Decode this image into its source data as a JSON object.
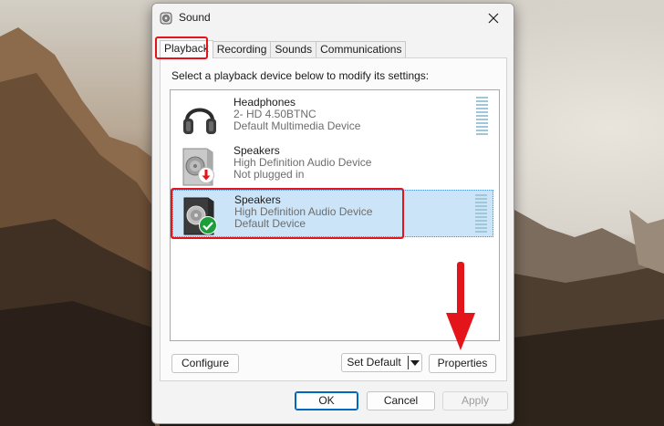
{
  "window": {
    "title": "Sound",
    "title_icon": "speaker-icon"
  },
  "tabs": [
    {
      "label": "Playback",
      "active": true
    },
    {
      "label": "Recording",
      "active": false
    },
    {
      "label": "Sounds",
      "active": false
    },
    {
      "label": "Communications",
      "active": false
    }
  ],
  "panel": {
    "instruction": "Select a playback device below to modify its settings:"
  },
  "devices": [
    {
      "name": "Headphones",
      "line2": "2- HD 4.50BTNC",
      "line3": "Default Multimedia Device",
      "icon": "headphones-icon"
    },
    {
      "name": "Speakers",
      "line2": "High Definition Audio Device",
      "line3": "Not plugged in",
      "icon": "speaker-device-icon",
      "status_icon": "unplugged-down-arrow-icon"
    },
    {
      "name": "Speakers",
      "line2": "High Definition Audio Device",
      "line3": "Default Device",
      "icon": "speaker-device-icon",
      "status_icon": "default-check-icon",
      "selected": true
    }
  ],
  "buttons": {
    "configure": "Configure",
    "set_default": "Set Default",
    "properties": "Properties",
    "ok": "OK",
    "cancel": "Cancel",
    "apply": "Apply"
  },
  "colors": {
    "annotation_red": "#e4141b",
    "selection_blue": "#cce4f7",
    "accent": "#0067c0",
    "check_green": "#1e9e3a"
  }
}
